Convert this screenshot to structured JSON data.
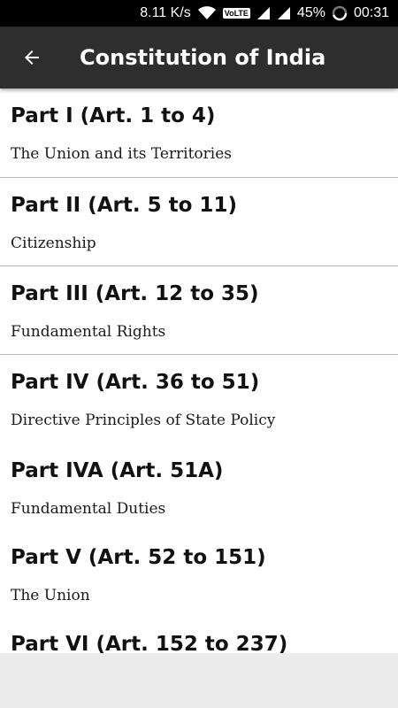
{
  "status_bar": {
    "speed": "8.11 K/s",
    "volte": "VoLTE",
    "battery": "45%",
    "time": "00:31"
  },
  "app_bar": {
    "title": "Constitution of India"
  },
  "parts": [
    {
      "title": "Part I (Art. 1 to 4)",
      "subtitle": "The Union and its Territories"
    },
    {
      "title": "Part II (Art. 5 to 11)",
      "subtitle": "Citizenship"
    },
    {
      "title": "Part III (Art. 12 to 35)",
      "subtitle": "Fundamental Rights"
    },
    {
      "title": "Part IV (Art. 36 to 51)",
      "subtitle": "Directive Principles of State Policy"
    },
    {
      "title": "Part IVA (Art. 51A)",
      "subtitle": "Fundamental Duties"
    },
    {
      "title": "Part V (Art. 52 to 151)",
      "subtitle": "The Union"
    },
    {
      "title": "Part VI (Art. 152 to 237)",
      "subtitle": ""
    }
  ]
}
